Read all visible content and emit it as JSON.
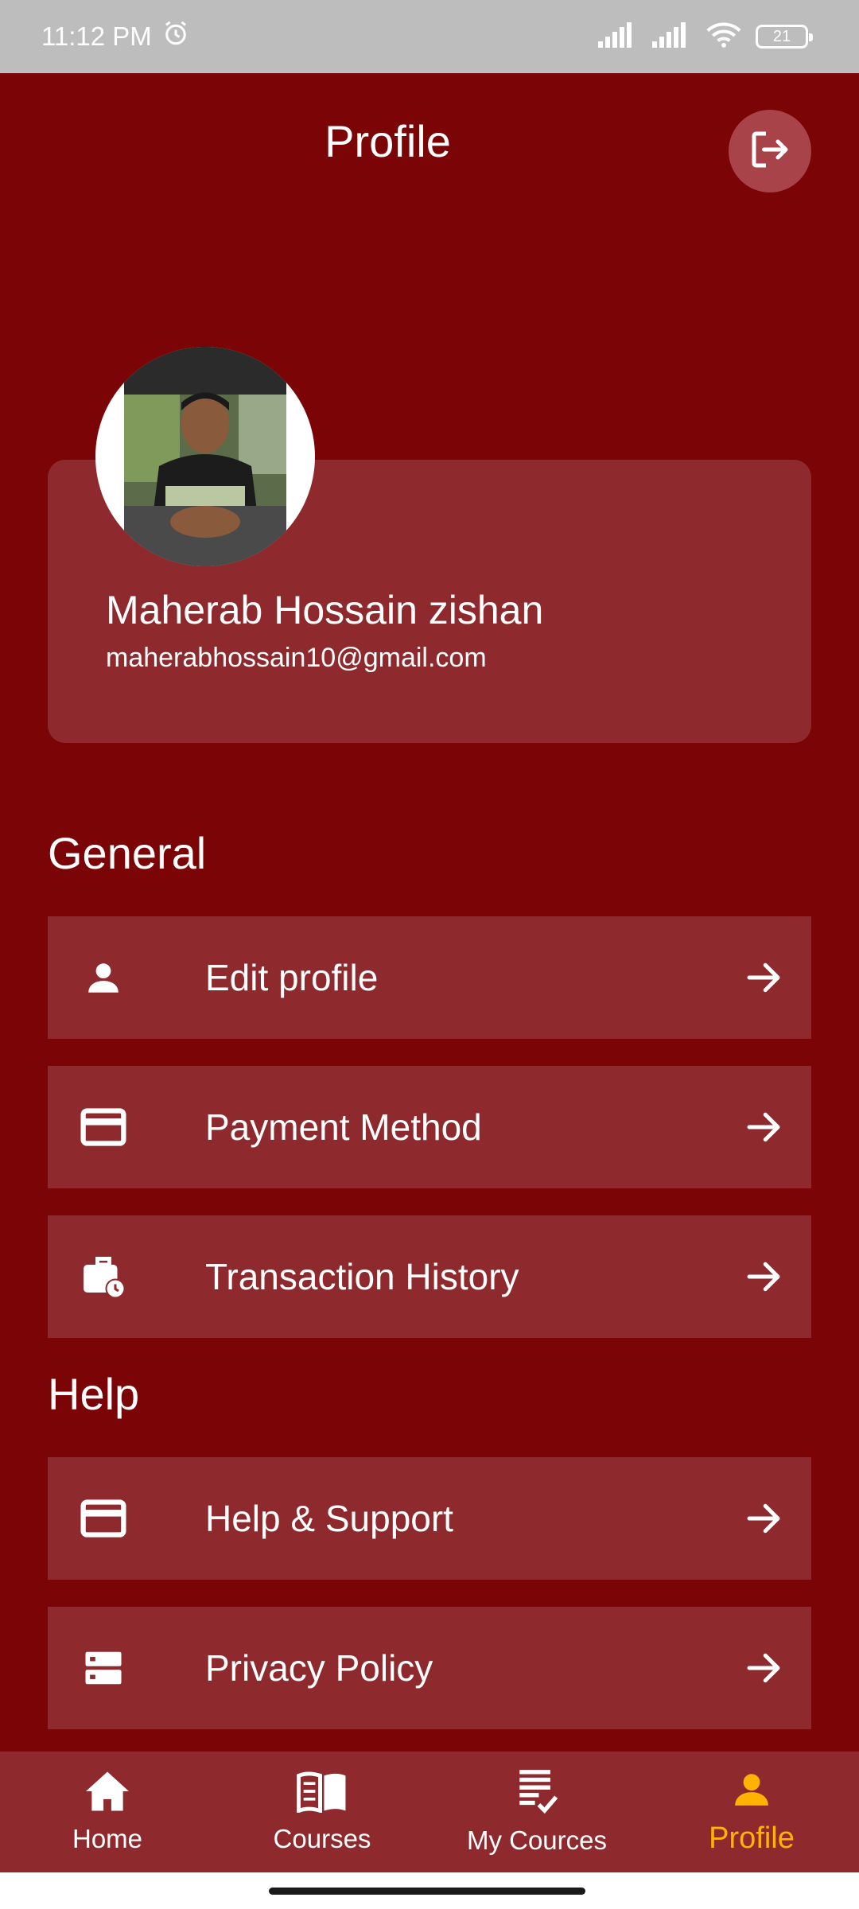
{
  "status_bar": {
    "time": "11:12 PM",
    "battery": "21",
    "icons": [
      "alarm-icon",
      "signal-icon",
      "signal-icon",
      "wifi-icon",
      "battery-icon"
    ]
  },
  "header": {
    "title": "Profile",
    "logout_icon": "logout-icon"
  },
  "profile": {
    "name": "Maherab Hossain zishan",
    "email": "maherabhossain10@gmail.com"
  },
  "sections": {
    "general": {
      "title": "General",
      "items": [
        {
          "label": "Edit profile",
          "icon": "person-icon"
        },
        {
          "label": "Payment Method",
          "icon": "credit-card-icon"
        },
        {
          "label": "Transaction History",
          "icon": "work-history-icon"
        }
      ]
    },
    "help": {
      "title": "Help",
      "items": [
        {
          "label": "Help & Support",
          "icon": "credit-card-icon"
        },
        {
          "label": "Privacy Policy",
          "icon": "storage-icon"
        }
      ]
    }
  },
  "bottom_nav": {
    "items": [
      {
        "label": "Home",
        "icon": "home-icon"
      },
      {
        "label": "Courses",
        "icon": "book-icon"
      },
      {
        "label": "My Cources",
        "icon": "checklist-icon"
      },
      {
        "label": "Profile",
        "icon": "person-icon",
        "active": true
      }
    ]
  },
  "colors": {
    "background": "#7a0406",
    "card": "#8e2a2d",
    "accent": "#ffb300",
    "status_bar": "#bdbdbd"
  }
}
